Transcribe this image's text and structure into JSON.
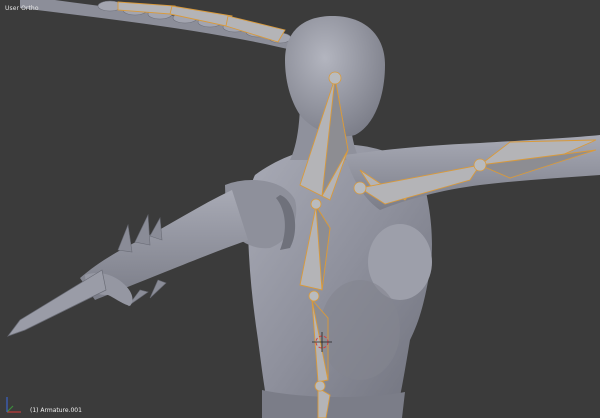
{
  "viewport": {
    "title": "User Ortho",
    "status": "(1) Armature.001",
    "background_color": "#3b3b3b"
  },
  "scene": {
    "mesh_color": "#9a9ca6",
    "bone_outline_color": "#d99a3b",
    "axis_x_color": "#c33c3c",
    "axis_y_color": "#3c8c3c",
    "axis_z_color": "#3c64c8"
  }
}
